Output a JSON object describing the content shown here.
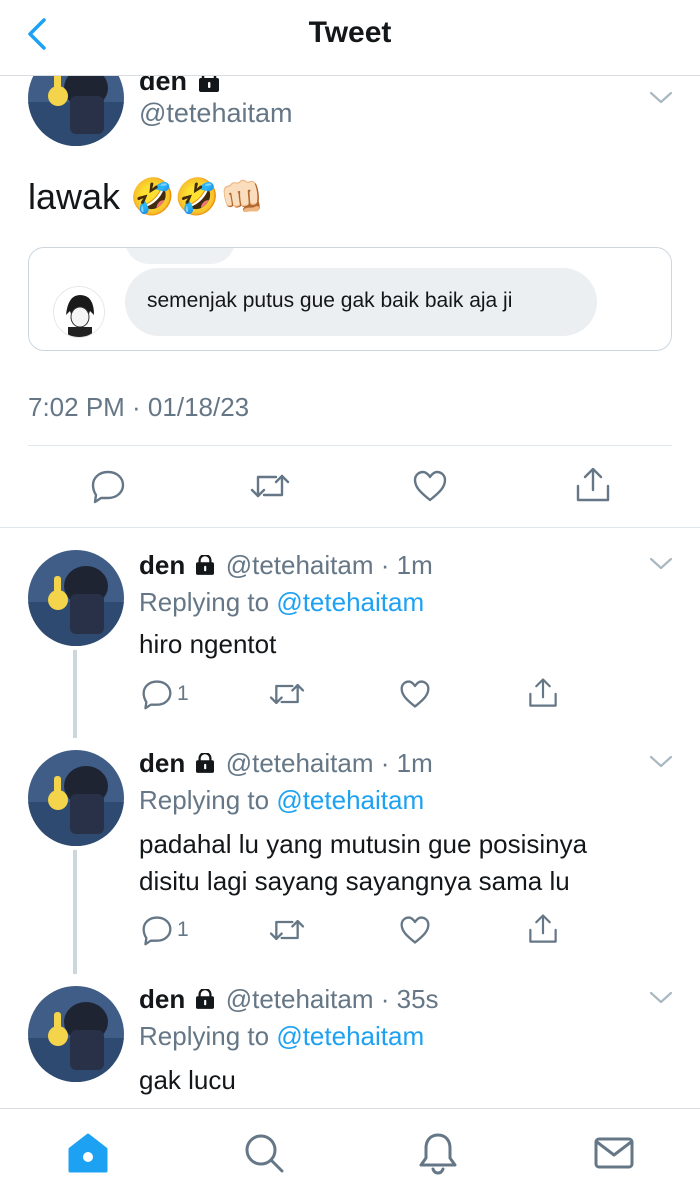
{
  "header": {
    "title": "Tweet",
    "back_icon": "chevron-left-icon"
  },
  "main_tweet": {
    "name": "den",
    "handle": "@tetehaitam",
    "text": "lawak 🤣🤣👊🏻",
    "quote_text": "semenjak putus gue gak baik baik aja ji",
    "timestamp": "7:02 PM · 01/18/23"
  },
  "replies": [
    {
      "name": "den",
      "handle": "@tetehaitam",
      "time": "· 1m",
      "replying_prefix": "Replying to ",
      "replying_to": "@tetehaitam",
      "text": "hiro ngentot",
      "reply_count": "1"
    },
    {
      "name": "den",
      "handle": "@tetehaitam",
      "time": "· 1m",
      "replying_prefix": "Replying to ",
      "replying_to": "@tetehaitam",
      "text_line1": "padahal lu yang mutusin gue posisinya",
      "text_line2": "disitu lagi sayang sayangnya sama lu",
      "reply_count": "1"
    },
    {
      "name": "den",
      "handle": "@tetehaitam",
      "time": "· 35s",
      "replying_prefix": "Replying to ",
      "replying_to": "@tetehaitam",
      "text": "gak lucu"
    }
  ],
  "tabbar": {
    "items": [
      "home-icon",
      "search-icon",
      "notifications-icon",
      "messages-icon"
    ],
    "active": "home-icon"
  },
  "colors": {
    "accent": "#1da1f2",
    "secondary_text": "#657786",
    "border": "#e1e8ed"
  }
}
